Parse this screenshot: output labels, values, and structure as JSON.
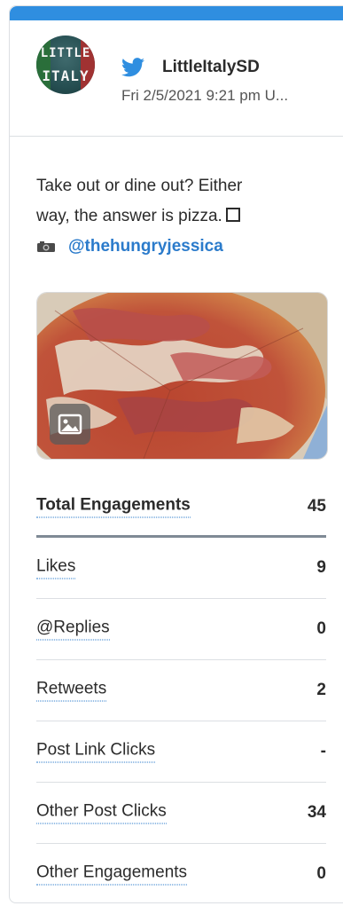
{
  "colors": {
    "accent": "#2f8ee0",
    "mention": "#2b7bcb",
    "divider": "#dcdfe3"
  },
  "header": {
    "avatar_text": [
      "LITTLE",
      "ITALY"
    ],
    "platform_icon": "twitter-bird-icon",
    "account_name": "LittleItalySD",
    "timestamp": "Fri 2/5/2021 9:21 pm U..."
  },
  "post": {
    "line1": "Take out or dine out? Either",
    "line2": "way, the answer is pizza.",
    "mention": "@thehungryjessica",
    "image_description_icon": "image-icon"
  },
  "metrics": [
    {
      "label": "Total Engagements",
      "value": "45"
    },
    {
      "label": "Likes",
      "value": "9"
    },
    {
      "label": "@Replies",
      "value": "0"
    },
    {
      "label": "Retweets",
      "value": "2"
    },
    {
      "label": "Post Link Clicks",
      "value": "-"
    },
    {
      "label": "Other Post Clicks",
      "value": "34"
    },
    {
      "label": "Other Engagements",
      "value": "0"
    }
  ]
}
